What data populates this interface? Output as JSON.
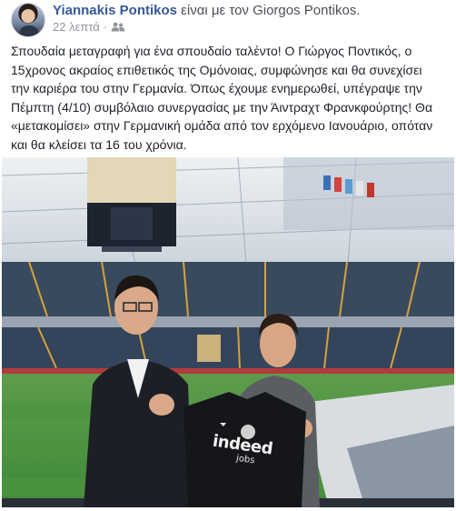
{
  "post": {
    "author": "Yiannakis Pontikos",
    "with_phrase": "είναι με τον",
    "tagged_person": "Giorgos Pontikos.",
    "timestamp": "22 λεπτά",
    "separator": "·",
    "audience_icon": "friends-icon",
    "lines": [
      "Σπουδαία μεταγραφή για ένα σπουδαίο ταλέντο! Ο Γιώργος Ποντικός, ο",
      "15χρονος ακραίος επιθετικός της Ομόνοιας, συμφώνησε και θα συνεχίσει",
      "την καριέρα του στην Γερμανία. Όπως έχουμε ενημερωθεί, υπέγραψε την",
      "Πέμπτη (4/10) συμβόλαιο συνεργασίας με την Άιντραχτ Φρανκφούρτης! Θα",
      "«μετακομίσει» στην Γερμανική ομάδα από τον ερχόμενο Ιανουάριο, οπόταν",
      "και θα κλείσει τα 16 του χρόνια."
    ],
    "photo": {
      "jersey_text": "indeed",
      "jersey_subtext": "jobs"
    }
  },
  "colors": {
    "link": "#365899",
    "meta": "#90949c",
    "text": "#1d2129",
    "pitch": "#3f8a3a",
    "seats": "#3a4a5e",
    "jersey": "#14161a"
  }
}
